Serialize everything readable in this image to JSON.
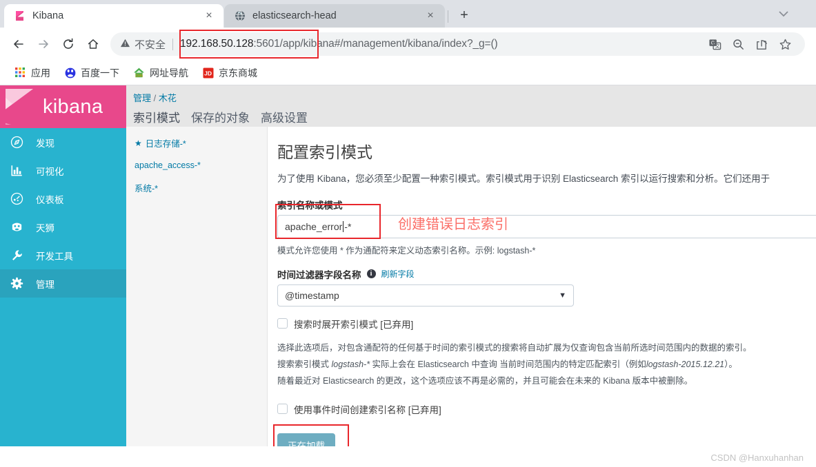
{
  "browser": {
    "tabs": [
      {
        "title": "Kibana",
        "favicon": "kibana-icon",
        "active": true,
        "close_label": "×"
      },
      {
        "title": "elasticsearch-head",
        "favicon": "globe-icon",
        "active": false,
        "close_label": "×"
      }
    ],
    "new_tab_label": "+",
    "window_chevron": "⌄",
    "nav": {
      "back": "←",
      "forward": "→",
      "reload": "⟳",
      "home": "⌂"
    },
    "omnibox": {
      "security_label": "不安全",
      "security_icon": "warning-triangle-icon",
      "url_host": "192.168.50.128",
      "url_port": ":5601",
      "url_path": "/app/kibana#/management/kibana/index?_g=()",
      "actions": [
        "translate-icon",
        "zoom-out-icon",
        "share-icon",
        "star-icon"
      ]
    },
    "bookmarks": [
      {
        "label": "应用",
        "icon": "apps-grid-icon"
      },
      {
        "label": "百度一下",
        "icon": "baidu-icon"
      },
      {
        "label": "网址导航",
        "icon": "2345-nav-icon"
      },
      {
        "label": "京东商城",
        "icon": "jd-icon"
      }
    ]
  },
  "kibana": {
    "brand": "kibana",
    "sidebar": [
      {
        "label": "发现",
        "icon": "discover-icon",
        "active": false
      },
      {
        "label": "可视化",
        "icon": "visualize-icon",
        "active": false
      },
      {
        "label": "仪表板",
        "icon": "dashboard-icon",
        "active": false
      },
      {
        "label": "天狮",
        "icon": "timelion-icon",
        "active": false
      },
      {
        "label": "开发工具",
        "icon": "wrench-icon",
        "active": false
      },
      {
        "label": "管理",
        "icon": "gear-icon",
        "active": true
      }
    ],
    "breadcrumb": {
      "root": "管理",
      "sep": "/",
      "current": "木花"
    },
    "tabs": [
      {
        "label": "索引模式",
        "active": true
      },
      {
        "label": "保存的对象",
        "active": false
      },
      {
        "label": "高级设置",
        "active": false
      }
    ],
    "index_patterns": [
      {
        "label": "日志存储-*",
        "starred": true,
        "star": "★"
      },
      {
        "label": "apache_access-*",
        "starred": false,
        "star": ""
      },
      {
        "label": "系统-*",
        "starred": false,
        "star": ""
      }
    ],
    "form": {
      "title": "配置索引模式",
      "lead": "为了使用 Kibana，您必须至少配置一种索引模式。索引模式用于识别 Elasticsearch 索引以运行搜索和分析。它们还用于",
      "index_label": "索引名称或模式",
      "index_value": "apache_error",
      "index_value_tail": "-*",
      "index_hint": "模式允许您使用 * 作为通配符来定义动态索引名称。示例: logstash-*",
      "annotation": "创建错误日志索引",
      "timefield_label": "时间过滤器字段名称",
      "refresh_fields": "刷新字段",
      "info_glyph": "i",
      "timefield_value": "@timestamp",
      "dropdown_caret": "▼",
      "checkbox_expand": "搜索时展开索引模式 [已弃用]",
      "deprecation_p1": "选择此选项后，对包含通配符的任何基于时间的索引模式的搜索将自动扩展为仅查询包含当前所选时间范围内的数据的索引。",
      "deprecation_p2_a": "搜索索引模式 ",
      "deprecation_p2_em1": "logstash-*",
      "deprecation_p2_b": " 实际上会在 Elasticsearch 中查询 当前时间范围内的特定匹配索引（例如",
      "deprecation_p2_em2": "logstash-2015.12.21",
      "deprecation_p2_c": "）。",
      "deprecation_p3": "随着最近对 Elasticsearch 的更改，这个选项应该不再是必需的，并且可能会在未来的 Kibana 版本中被删除。",
      "checkbox_event_time": "使用事件时间创建索引名称 [已弃用]",
      "submit_label": "正在加载"
    }
  },
  "watermark": "CSDN @Hanxuhanhan",
  "colors": {
    "kibana_pink": "#e8488b",
    "kibana_blue": "#28b3cf",
    "link": "#0079a5",
    "annotation_red": "#fb6f68",
    "highlight_red": "#e8262b",
    "button": "#6eadc1"
  }
}
